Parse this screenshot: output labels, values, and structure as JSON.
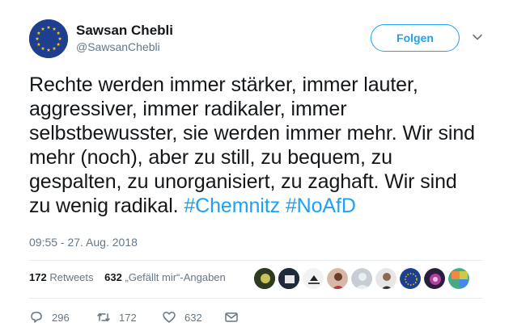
{
  "user": {
    "display_name": "Sawsan Chebli",
    "handle": "@SawsanChebli",
    "avatar_icon": "eu-flag-icon"
  },
  "follow_label": "Folgen",
  "tweet": {
    "text_plain": "Rechte werden immer stärker, immer lauter, aggressiver, immer radikaler, immer selbstbewusster, sie werden immer mehr. Wir sind mehr (noch), aber zu still, zu bequem, zu gespalten, zu unorganisiert, zu zaghaft. Wir sind zu wenig radikal.",
    "hashtags": [
      "#Chemnitz",
      "#NoAfD"
    ],
    "timestamp": "09:55 - 27. Aug. 2018"
  },
  "stats": {
    "retweets_count": "172",
    "retweets_label": "Retweets",
    "likes_count": "632",
    "likes_label": "„Gefällt mir“-Angaben"
  },
  "liker_avatars": [
    "avatar-1",
    "avatar-2",
    "avatar-3",
    "avatar-4",
    "avatar-5",
    "avatar-6",
    "avatar-7",
    "avatar-8",
    "avatar-9"
  ],
  "actions": {
    "reply_count": "296",
    "retweet_count": "172",
    "like_count": "632"
  },
  "colors": {
    "accent": "#1da1f2",
    "text": "#14171a",
    "secondary": "#657786",
    "divider": "#e6ecf0"
  }
}
